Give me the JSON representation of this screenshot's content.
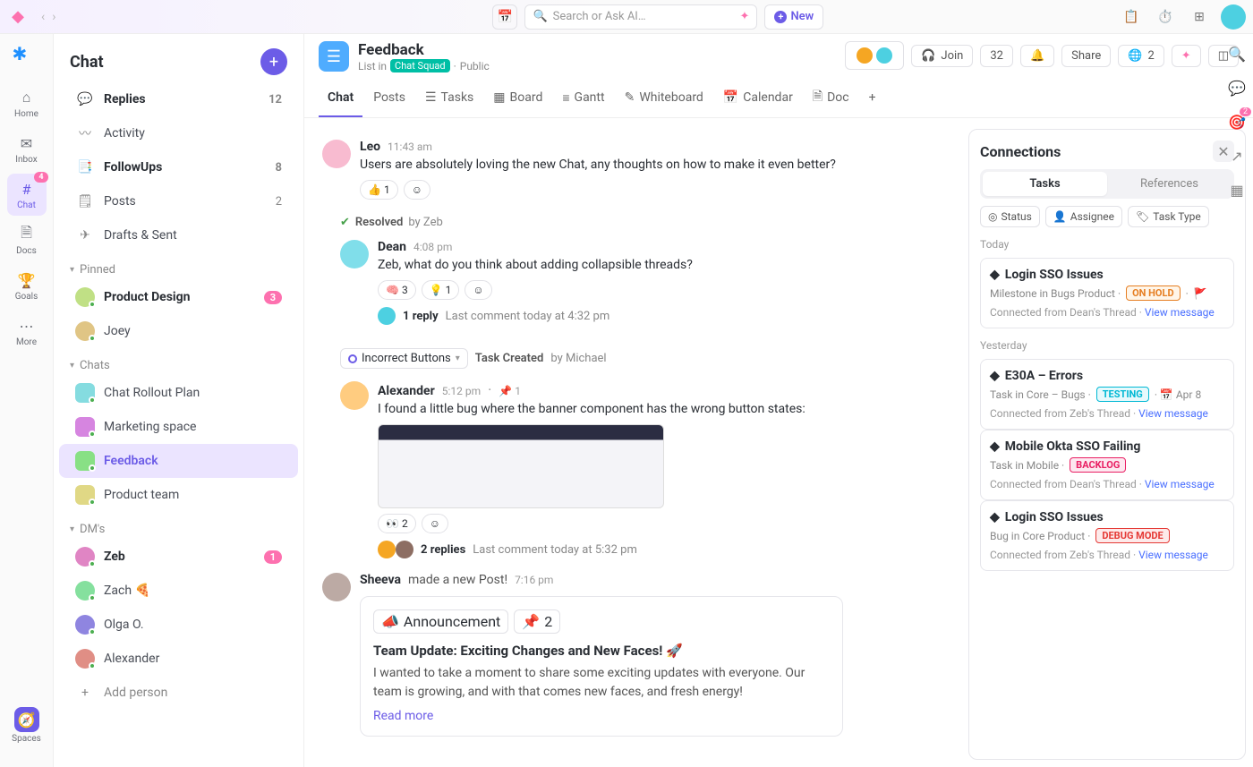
{
  "top": {
    "search_placeholder": "Search or Ask AI…",
    "new_label": "New"
  },
  "rail": {
    "home": "Home",
    "inbox": "Inbox",
    "chat": "Chat",
    "chat_badge": "4",
    "docs": "Docs",
    "goals": "Goals",
    "more": "More",
    "spaces": "Spaces"
  },
  "chatPanel": {
    "title": "Chat",
    "nav": [
      {
        "label": "Replies",
        "count": "12",
        "bold": true
      },
      {
        "label": "Activity"
      },
      {
        "label": "FollowUps",
        "count": "8",
        "bold": true
      },
      {
        "label": "Posts",
        "count": "2"
      },
      {
        "label": "Drafts & Sent"
      }
    ],
    "pinned_hdr": "Pinned",
    "pinned": [
      {
        "label": "Product Design",
        "count": "3",
        "bold": true
      },
      {
        "label": "Joey"
      }
    ],
    "chats_hdr": "Chats",
    "chats": [
      {
        "label": "Chat Rollout Plan"
      },
      {
        "label": "Marketing space"
      },
      {
        "label": "Feedback",
        "active": true
      },
      {
        "label": "Product team"
      }
    ],
    "dms_hdr": "DM's",
    "dms": [
      {
        "label": "Zeb",
        "count": "1",
        "bold": true
      },
      {
        "label": "Zach 🍕"
      },
      {
        "label": "Olga O."
      },
      {
        "label": "Alexander"
      }
    ],
    "add_person": "Add person"
  },
  "header": {
    "title": "Feedback",
    "list_in": "List in",
    "squad": "Chat Squad",
    "public": "Public",
    "join": "Join",
    "count": "32",
    "share": "Share",
    "globe_count": "2"
  },
  "tabs": [
    "Chat",
    "Posts",
    "Tasks",
    "Board",
    "Gantt",
    "Whiteboard",
    "Calendar",
    "Doc"
  ],
  "messages": {
    "leo": {
      "name": "Leo",
      "time": "11:43 am",
      "text": "Users are absolutely loving the new Chat, any thoughts on how to make it even better?",
      "react_count": "1"
    },
    "resolved": {
      "label": "Resolved",
      "by": "by Zeb"
    },
    "dean": {
      "name": "Dean",
      "time": "4:08 pm",
      "text": "Zeb, what do you think about adding collapsible threads?",
      "r1": "3",
      "r2": "1",
      "reply": "1 reply",
      "last": "Last comment today at 4:32 pm"
    },
    "task": {
      "chip": "Incorrect Buttons",
      "label": "Task Created",
      "by": "by Michael"
    },
    "alex": {
      "name": "Alexander",
      "time": "5:12 pm",
      "pin": "1",
      "text": "I found a little bug where the banner component has the wrong button states:",
      "eyes": "2",
      "replies": "2 replies",
      "last": "Last comment today at 5:32 pm"
    },
    "sheeva": {
      "name": "Sheeva",
      "made": "made a new Post!",
      "time": "7:16 pm"
    },
    "post": {
      "tag": "Announcement",
      "pin": "2",
      "title": "Team Update: Exciting Changes and New Faces! 🚀",
      "body": "I wanted to take a moment to share some exciting updates with everyone. Our team is growing, and with that comes new faces, and fresh energy!",
      "read": "Read more"
    }
  },
  "conn": {
    "title": "Connections",
    "tab_tasks": "Tasks",
    "tab_refs": "References",
    "filters": [
      "Status",
      "Assignee",
      "Task Type"
    ],
    "today": "Today",
    "yesterday": "Yesterday",
    "cards": [
      {
        "title": "Login SSO Issues",
        "sub": "Milestone in Bugs Product",
        "status": "ON HOLD",
        "statusCls": "hold",
        "flag": true,
        "foot": "Connected from Dean's Thread",
        "link": "View message"
      },
      {
        "title": "E30A – Errors",
        "sub": "Task in Core – Bugs",
        "status": "TESTING",
        "statusCls": "test",
        "date": "Apr 8",
        "foot": "Connected from Zeb's Thread",
        "link": "View message"
      },
      {
        "title": "Mobile Okta SSO Failing",
        "sub": "Task in Mobile",
        "status": "BACKLOG",
        "statusCls": "backlog",
        "foot": "Connected from Dean's Thread",
        "link": "View message"
      },
      {
        "title": "Login SSO Issues",
        "sub": "Bug in Core Product",
        "status": "DEBUG MODE",
        "statusCls": "debug",
        "foot": "Connected from Zeb's Thread",
        "link": "View message"
      }
    ]
  },
  "edge": {
    "badge": "2"
  }
}
